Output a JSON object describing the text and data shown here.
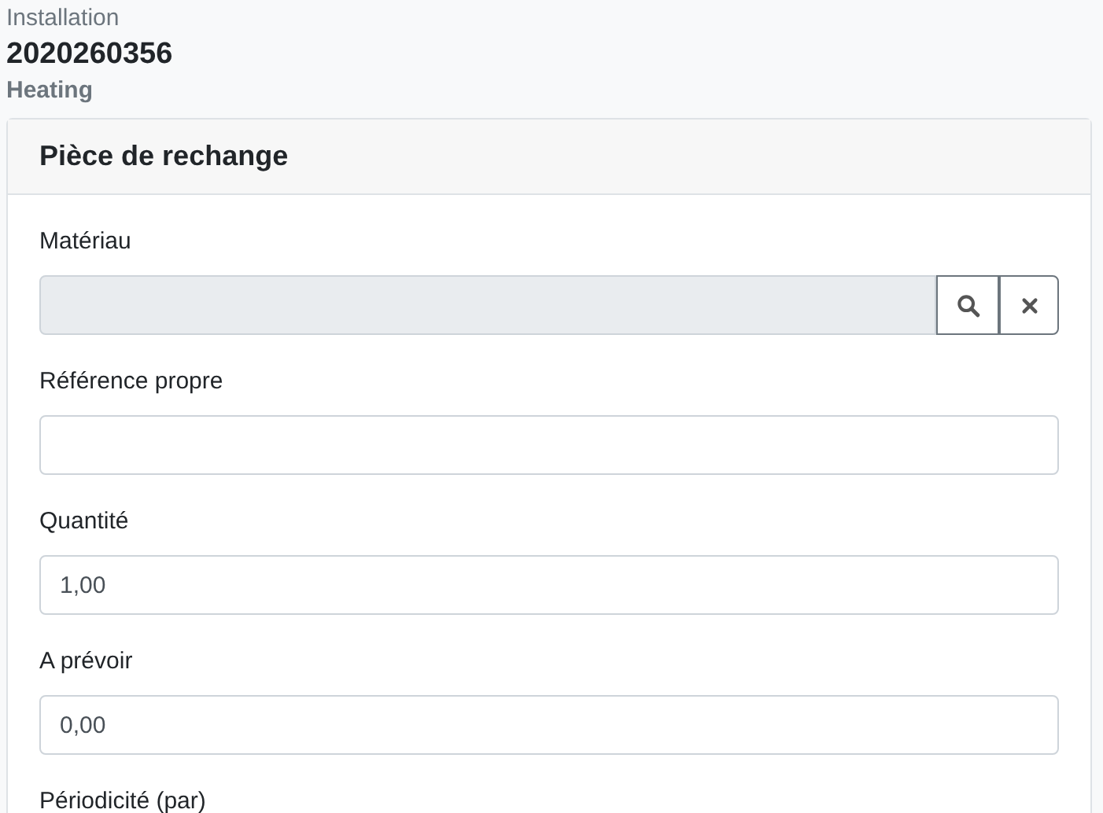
{
  "header": {
    "label": "Installation",
    "number": "2020260356",
    "category": "Heating"
  },
  "card": {
    "title": "Pièce de rechange",
    "fields": [
      {
        "kind": "lookup",
        "label": "Matériau",
        "disabled": true
      },
      {
        "kind": "text",
        "label": "Référence propre"
      },
      {
        "kind": "text",
        "label": "Quantité",
        "value": "1,00"
      },
      {
        "kind": "text",
        "label": "A prévoir",
        "value": "0,00"
      },
      {
        "kind": "label",
        "label": "Périodicité (par)"
      }
    ]
  }
}
